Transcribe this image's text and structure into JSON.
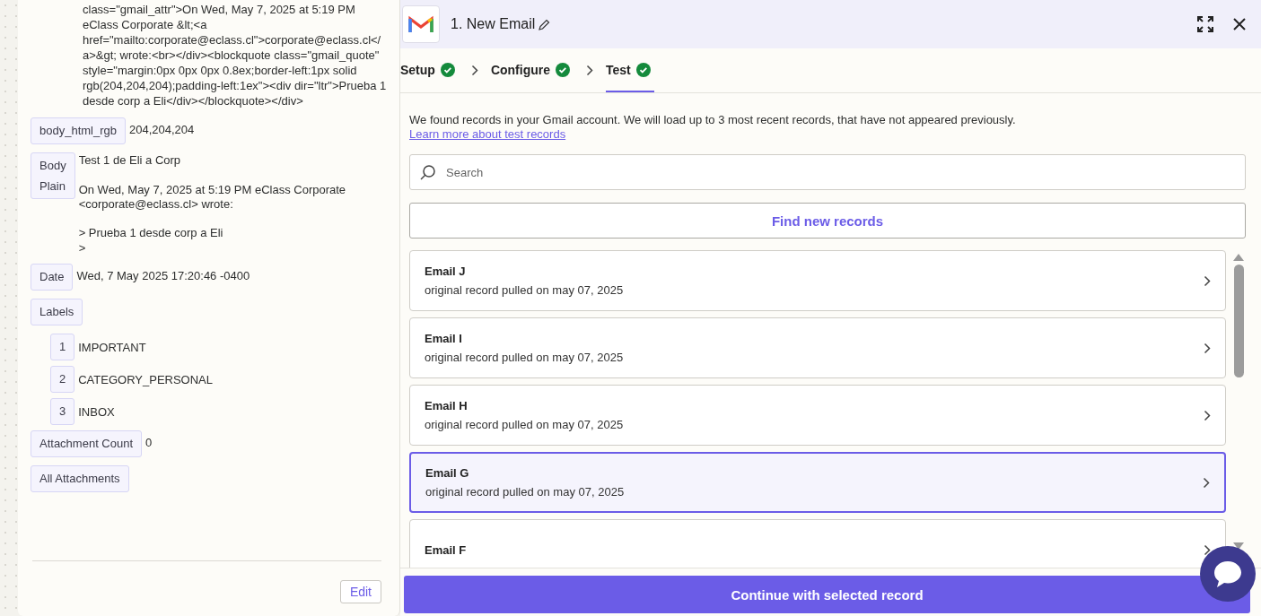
{
  "data_panel": {
    "body_html_tail": "class=\"gmail_attr\">On Wed, May 7, 2025 at 5:19 PM eClass Corporate &lt;<a href=\"mailto:corporate@eclass.cl\">corporate@eclass.cl</a>&gt; wrote:<br></div><blockquote class=\"gmail_quote\" style=\"margin:0px 0px 0px 0.8ex;border-left:1px solid rgb(204,204,204);padding-left:1ex\"><div dir=\"ltr\">Prueba 1 desde corp a Eli</div></blockquote></div>",
    "fields": [
      {
        "kind": "value",
        "label": "body_html_rgb",
        "value": "204,204,204"
      },
      {
        "kind": "value",
        "label": "Body Plain",
        "value": "Test 1 de Eli a Corp\n\nOn Wed, May 7, 2025 at 5:19 PM eClass Corporate <corporate@eclass.cl> wrote:\n\n> Prueba 1 desde corp a Eli\n>"
      },
      {
        "kind": "value",
        "label": "Date",
        "value": "Wed, 7 May 2025 17:20:46 -0400"
      },
      {
        "kind": "list",
        "label": "Labels",
        "items": [
          {
            "index": "1",
            "value": "IMPORTANT"
          },
          {
            "index": "2",
            "value": "CATEGORY_PERSONAL"
          },
          {
            "index": "3",
            "value": "INBOX"
          }
        ]
      },
      {
        "kind": "value",
        "label": "Attachment Count",
        "value": "0"
      },
      {
        "kind": "value",
        "label": "All Attachments"
      }
    ],
    "edit_button": "Edit"
  },
  "step": {
    "title": "1. New Email",
    "tabs": [
      {
        "label": "Setup",
        "selected": false,
        "done": true
      },
      {
        "label": "Configure",
        "selected": false,
        "done": true
      },
      {
        "label": "Test",
        "selected": true,
        "done": true
      }
    ],
    "intro": "We found records in your Gmail account. We will load up to 3 most recent records, that have not appeared previously.",
    "learn_link": "Learn more about test records",
    "search": {
      "placeholder": "Search"
    },
    "find_button": "Find new records",
    "records": [
      {
        "title": "Email J",
        "subtitle": "original record pulled on may 07, 2025",
        "selected": false
      },
      {
        "title": "Email I",
        "subtitle": "original record pulled on may 07, 2025",
        "selected": false
      },
      {
        "title": "Email H",
        "subtitle": "original record pulled on may 07, 2025",
        "selected": false
      },
      {
        "title": "Email G",
        "subtitle": "original record pulled on may 07, 2025",
        "selected": true
      },
      {
        "title": "Email F",
        "selected": false
      }
    ],
    "continue_button": "Continue with selected record"
  }
}
